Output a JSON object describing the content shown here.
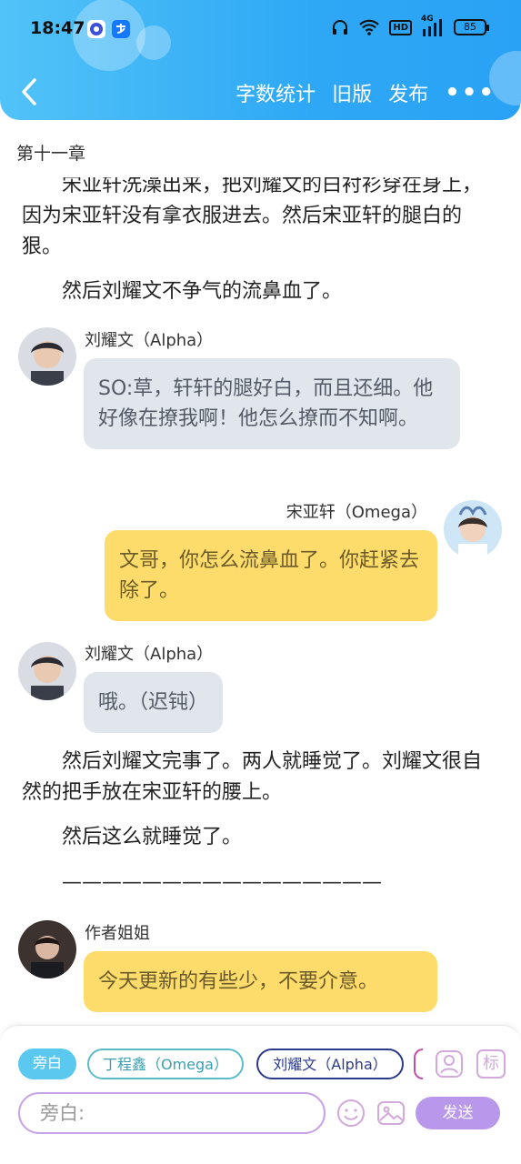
{
  "status_bar": {
    "time": "18:47",
    "battery": "85",
    "network_label": "4G",
    "hd_label": "HD"
  },
  "nav": {
    "actions": [
      "字数统计",
      "旧版",
      "发布"
    ],
    "more": "•••"
  },
  "chapter": {
    "title": "第十一章"
  },
  "content": {
    "para_1": "宋亚轩洗澡出来，把刘耀文的白衬衫穿在身上，因为宋亚轩没有拿衣服进去。然后宋亚轩的腿白的狠。",
    "para_2": "然后刘耀文不争气的流鼻血了。",
    "msg_1": {
      "speaker": "刘耀文（Alpha）",
      "text": "SO:草，轩轩的腿好白，而且还细。他好像在撩我啊！他怎么撩而不知啊。"
    },
    "msg_2": {
      "speaker": "宋亚轩（Omega）",
      "text": "文哥，你怎么流鼻血了。你赶紧去除了。"
    },
    "msg_3": {
      "speaker": "刘耀文（Alpha）",
      "text": "哦。（迟钝）"
    },
    "para_3": "然后刘耀文完事了。两人就睡觉了。刘耀文很自然的把手放在宋亚轩的腰上。",
    "para_4": "然后这么就睡觉了。",
    "divider": "————————————————",
    "msg_4": {
      "speaker": "作者姐姐",
      "text": "今天更新的有些少，不要介意。"
    }
  },
  "bottom": {
    "chips": [
      "旁白",
      "丁程鑫（Omega）",
      "刘耀文（Alpha）"
    ],
    "role_icon_label": "标",
    "input_placeholder": "旁白:",
    "send_label": "发送"
  },
  "colors": {
    "header": "#2ea8f5",
    "bubble_gray": "#e1e6ed",
    "bubble_yellow": "#fedc6b",
    "send": "#b997ea"
  }
}
